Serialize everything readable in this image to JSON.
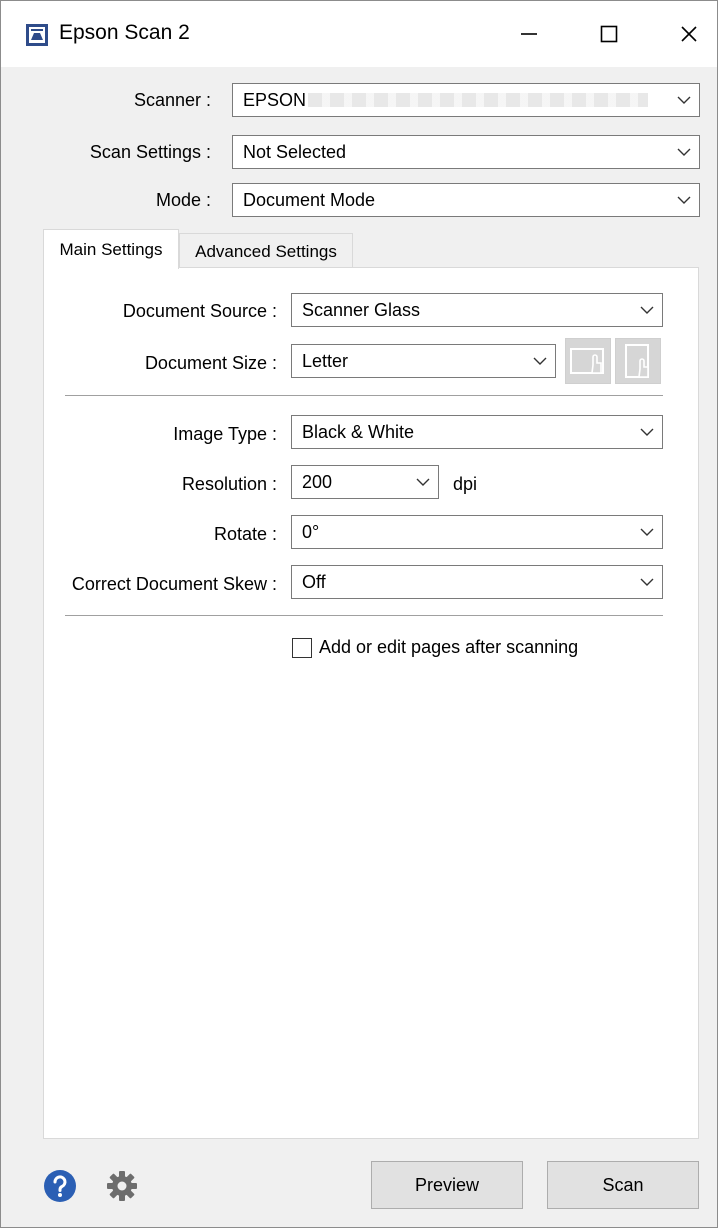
{
  "window": {
    "title": "Epson Scan 2",
    "app_icon": "epson-scan-icon",
    "controls": [
      "minimize-icon",
      "maximize-icon",
      "close-icon"
    ]
  },
  "top_settings": {
    "scanner": {
      "label": "Scanner :",
      "value": "EPSON"
    },
    "scan_settings": {
      "label": "Scan Settings :",
      "value": "Not Selected"
    },
    "mode": {
      "label": "Mode :",
      "value": "Document Mode"
    }
  },
  "tabs": [
    {
      "label": "Main Settings",
      "active": true
    },
    {
      "label": "Advanced Settings",
      "active": false
    }
  ],
  "main_settings": {
    "document_source": {
      "label": "Document Source :",
      "value": "Scanner Glass"
    },
    "document_size": {
      "label": "Document Size :",
      "value": "Letter",
      "icons": [
        "landscape-orientation-icon",
        "portrait-orientation-icon"
      ]
    },
    "image_type": {
      "label": "Image Type :",
      "value": "Black & White"
    },
    "resolution": {
      "label": "Resolution :",
      "value": "200",
      "unit": "dpi"
    },
    "rotate": {
      "label": "Rotate :",
      "value": "0°"
    },
    "correct_skew": {
      "label": "Correct Document Skew :",
      "value": "Off"
    },
    "add_edit_pages": {
      "label": "Add or edit pages after scanning",
      "checked": false
    }
  },
  "footer": {
    "help_icon": "help-icon",
    "settings_icon": "gear-icon",
    "preview_label": "Preview",
    "scan_label": "Scan"
  },
  "colors": {
    "window_bg": "#f0f0f0",
    "help_blue": "#2b5fb4",
    "gear_gray": "#6d6d6d",
    "button_bg": "#e1e1e1"
  }
}
